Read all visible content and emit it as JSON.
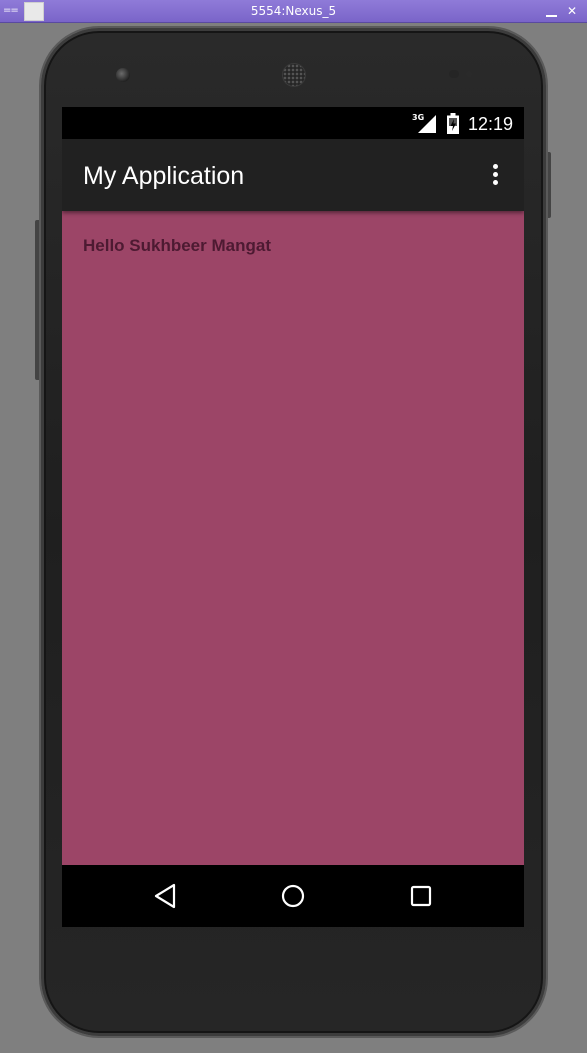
{
  "window": {
    "title": "5554:Nexus_5",
    "menu_glyph": "==",
    "close_glyph": "✕"
  },
  "status_bar": {
    "network_type": "3G",
    "time": "12:19",
    "icons": [
      "signal-icon",
      "battery-icon"
    ]
  },
  "app_bar": {
    "title": "My Application",
    "overflow_icon": "more-vert-icon"
  },
  "content": {
    "greeting": "Hello Sukhbeer Mangat"
  },
  "nav_bar": {
    "icons": [
      "back-icon",
      "home-icon",
      "recents-icon"
    ]
  },
  "colors": {
    "content_background": "#9c4567",
    "app_bar": "#212121",
    "greeting_text": "#4d1a32",
    "title_bar": "#7a64c9"
  }
}
